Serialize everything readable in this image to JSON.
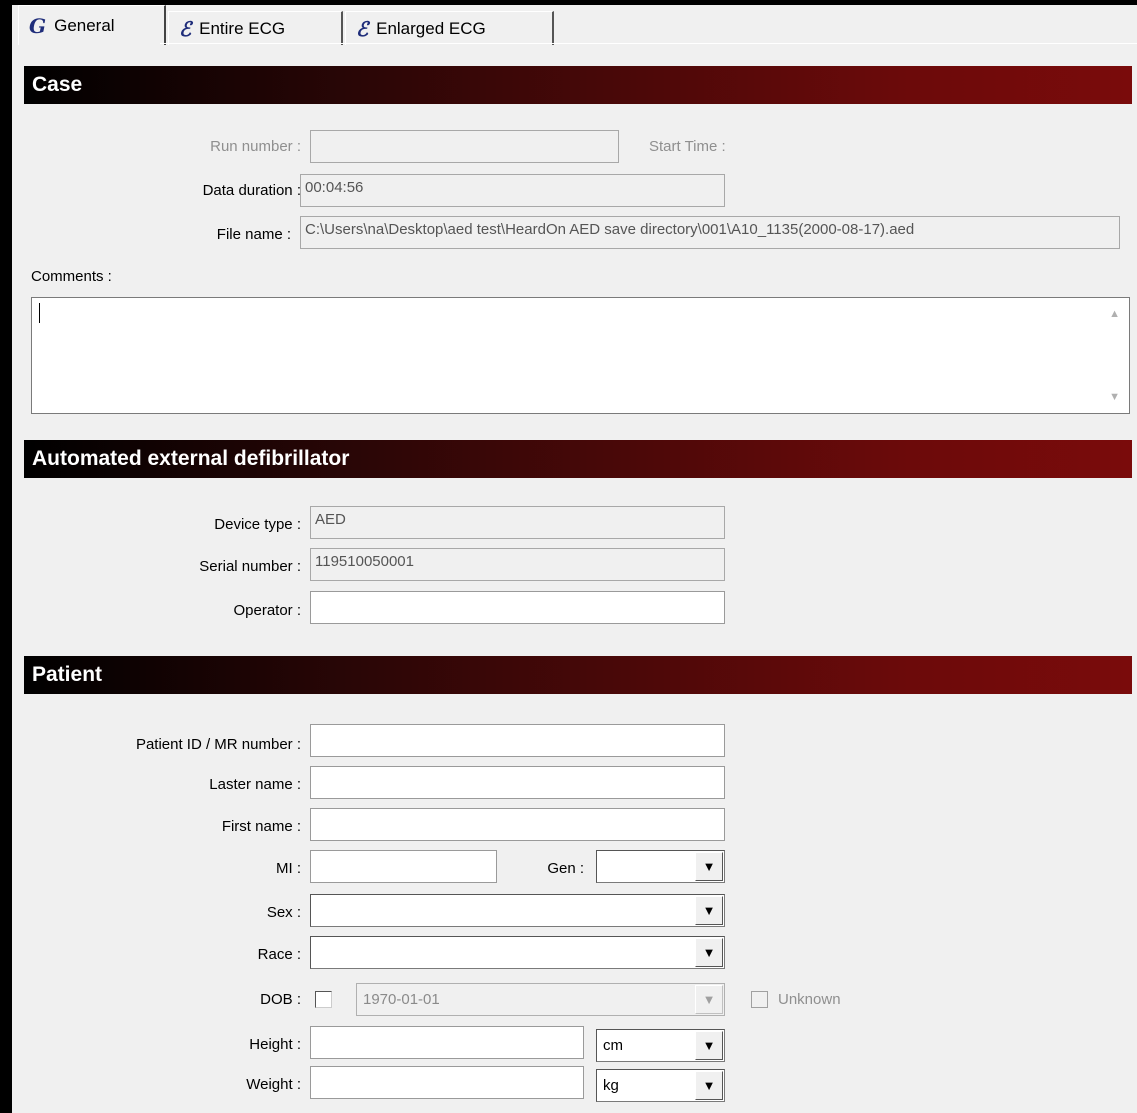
{
  "tabs": [
    {
      "label": "General",
      "icon": "general-tab-icon"
    },
    {
      "label": "Entire ECG",
      "icon": "ecg-tab-icon"
    },
    {
      "label": "Enlarged ECG",
      "icon": "ecg-tab-icon"
    }
  ],
  "case": {
    "title": "Case",
    "run_number_label": "Run number :",
    "run_number_value": "",
    "start_time_label": "Start Time :",
    "data_duration_label": "Data duration :",
    "data_duration_value": "00:04:56",
    "file_name_label": "File name :",
    "file_name_value": "C:\\Users\\na\\Desktop\\aed test\\HeardOn AED save directory\\001\\A10_1135(2000-08-17).aed",
    "comments_label": "Comments :",
    "comments_value": ""
  },
  "aed": {
    "title": "Automated external defibrillator",
    "device_type_label": "Device type :",
    "device_type_value": "AED",
    "serial_number_label": "Serial number :",
    "serial_number_value": "119510050001",
    "operator_label": "Operator :",
    "operator_value": ""
  },
  "patient": {
    "title": "Patient",
    "patient_id_label": "Patient ID / MR number :",
    "last_name_label": "Laster name :",
    "first_name_label": "First name :",
    "mi_label": "MI :",
    "gen_label": "Gen :",
    "gen_value": "",
    "sex_label": "Sex :",
    "sex_value": "",
    "race_label": "Race :",
    "race_value": "",
    "dob_label": "DOB :",
    "dob_value": "1970-01-01",
    "unknown_label": "Unknown",
    "height_label": "Height :",
    "height_unit": "cm",
    "weight_label": "Weight :",
    "weight_unit": "kg"
  }
}
